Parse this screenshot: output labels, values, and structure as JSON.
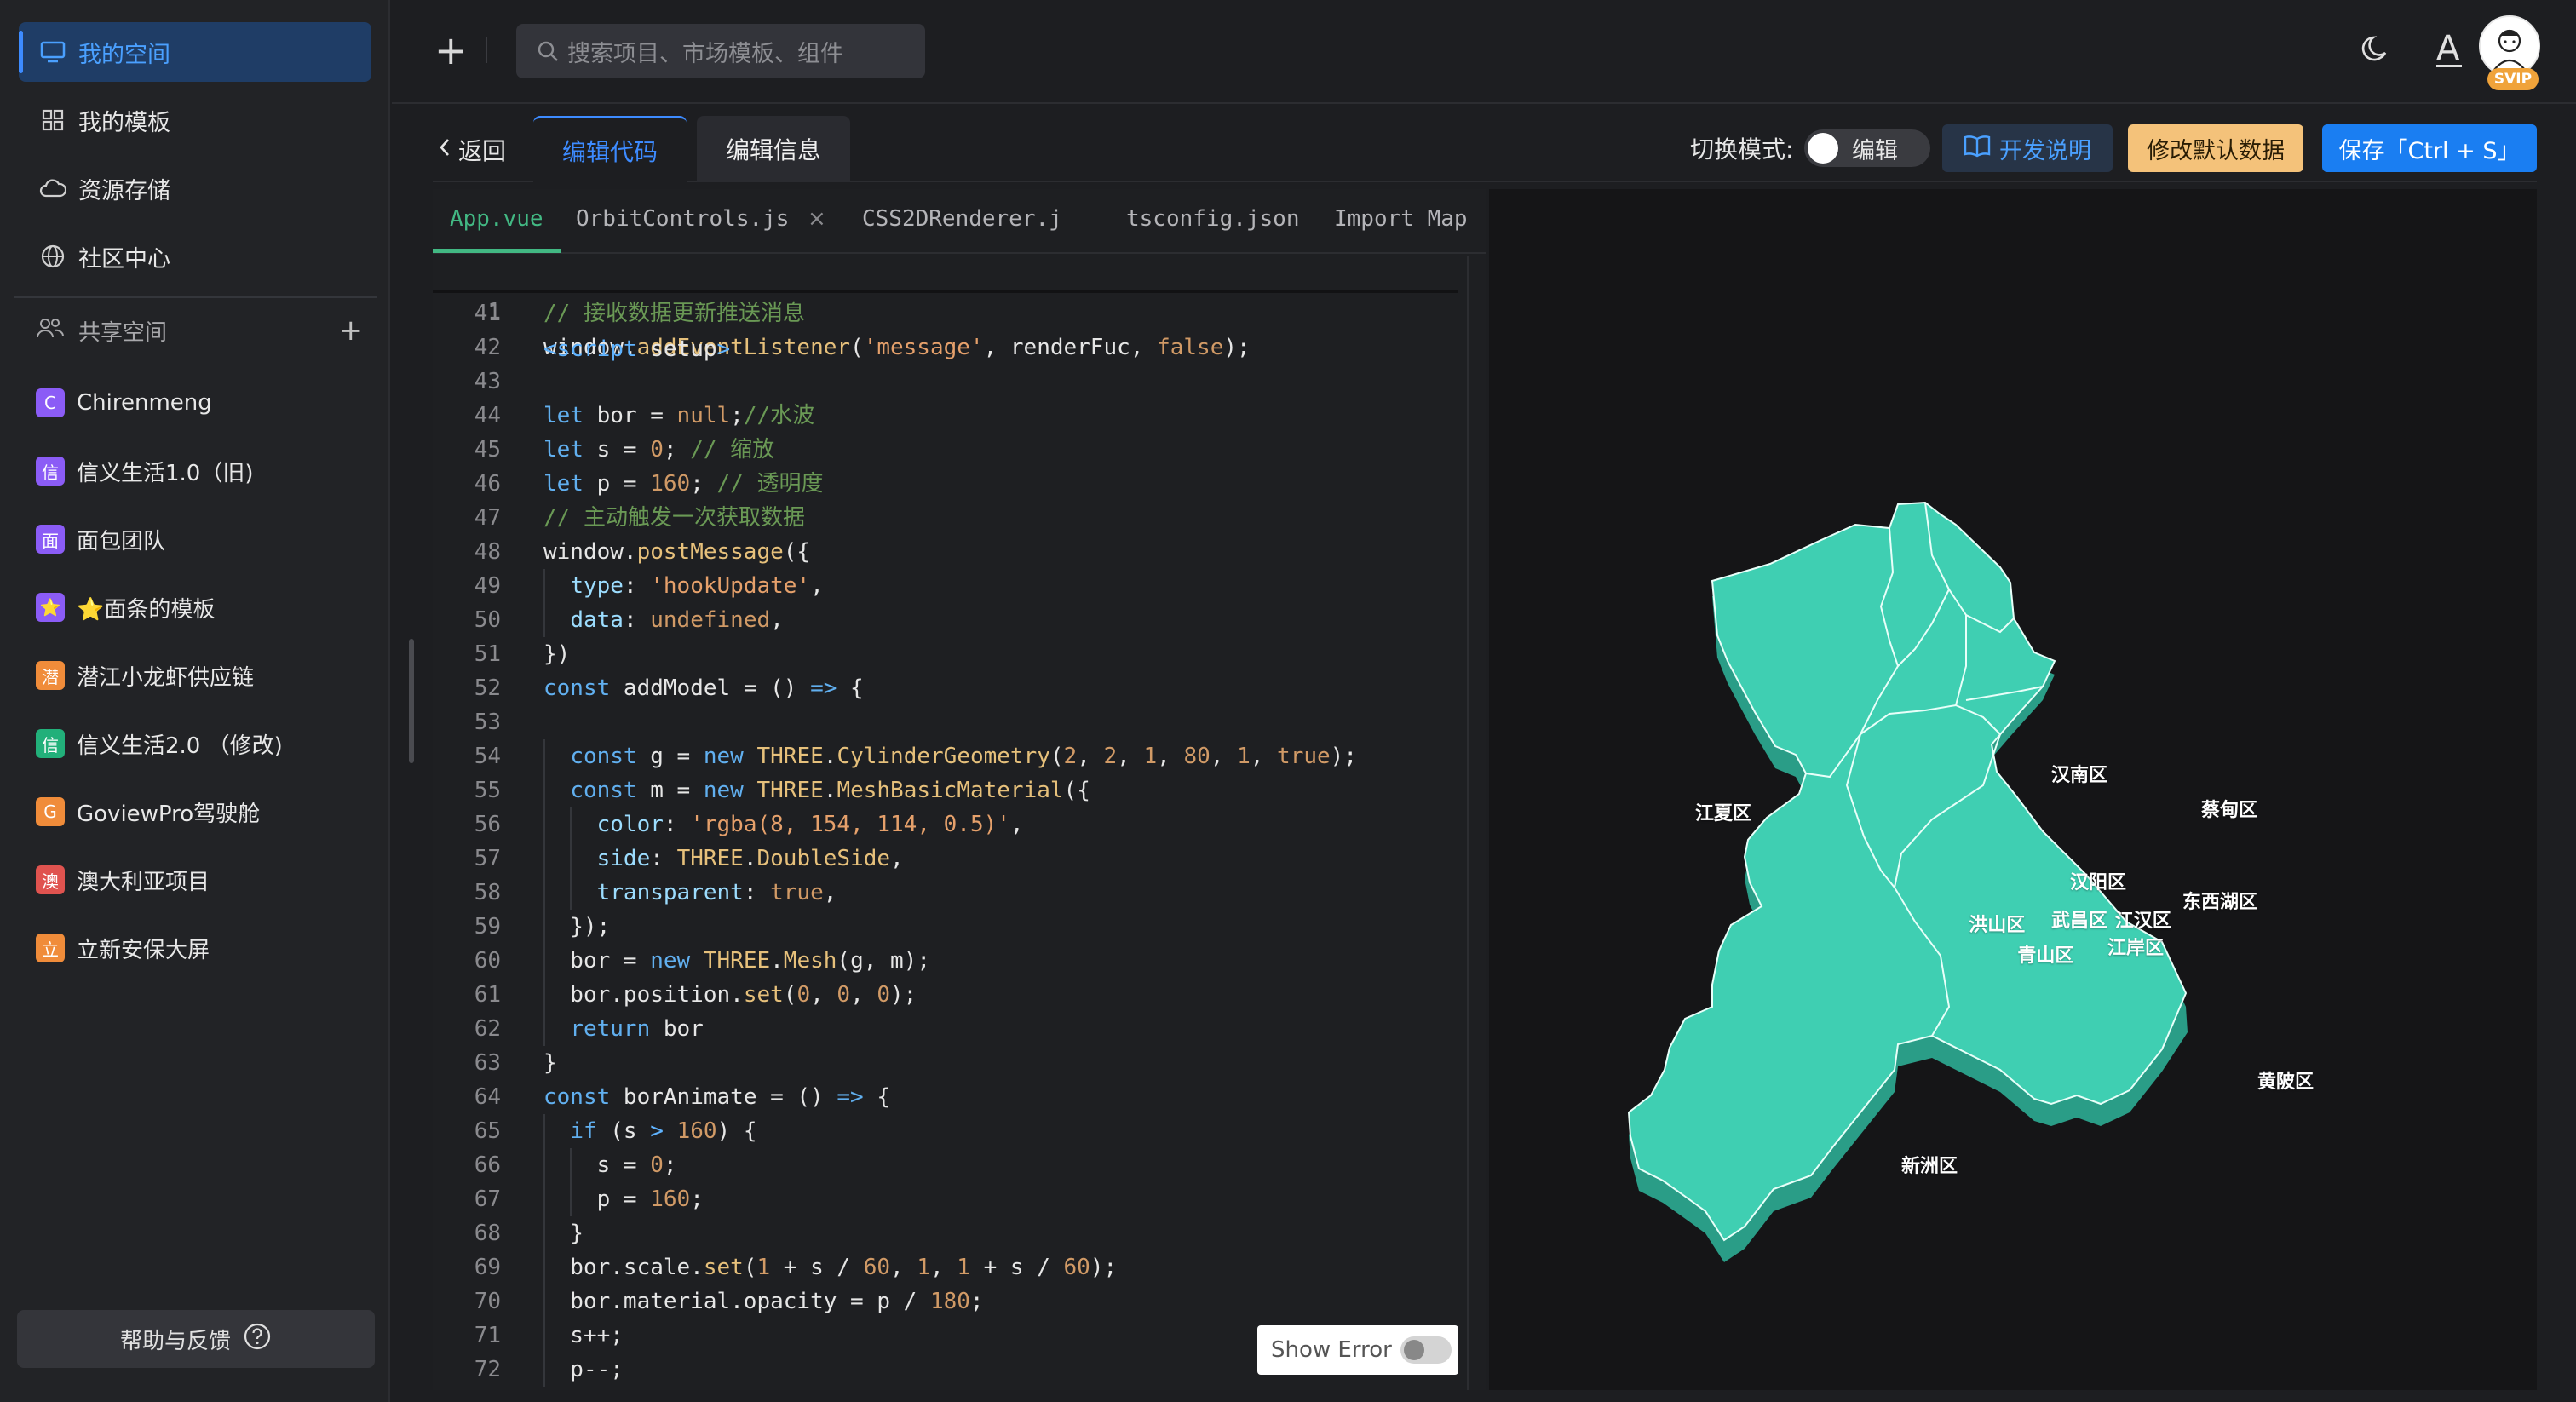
{
  "sidebar": {
    "nav": [
      {
        "label": "我的空间",
        "icon": "monitor-icon",
        "active": true
      },
      {
        "label": "我的模板",
        "icon": "template-icon",
        "active": false
      },
      {
        "label": "资源存储",
        "icon": "cloud-icon",
        "active": false
      },
      {
        "label": "社区中心",
        "icon": "globe-icon",
        "active": false
      }
    ],
    "shared_title": "共享空间",
    "teams": [
      {
        "badge": "C",
        "label": "Chirenmeng",
        "color": "#8b5cf6"
      },
      {
        "badge": "信",
        "label": "信义生活1.0（旧)",
        "color": "#8b5cf6"
      },
      {
        "badge": "面",
        "label": "面包团队",
        "color": "#8b5cf6"
      },
      {
        "badge": "⭐",
        "label": "⭐面条的模板",
        "color": "#8b5cf6"
      },
      {
        "badge": "潜",
        "label": "潜江小龙虾供应链",
        "color": "#f08c3a"
      },
      {
        "badge": "信",
        "label": "信义生活2.0 （修改)",
        "color": "#22b07a"
      },
      {
        "badge": "G",
        "label": "GoviewPro驾驶舱",
        "color": "#f08c3a"
      },
      {
        "badge": "澳",
        "label": "澳大利亚项目",
        "color": "#e0534f"
      },
      {
        "badge": "立",
        "label": "立新安保大屏",
        "color": "#f08c3a"
      }
    ],
    "help_label": "帮助与反馈"
  },
  "topbar": {
    "search_placeholder": "搜索项目、市场模板、组件",
    "font_letter": "A",
    "svip": "SVIP"
  },
  "toolbar": {
    "back_label": "返回",
    "tabs": [
      "编辑代码",
      "编辑信息"
    ],
    "mode_label": "切换模式:",
    "mode_value": "编辑",
    "doc_label": "开发说明",
    "default_data_label": "修改默认数据",
    "save_label": "保存「Ctrl + S」"
  },
  "editor": {
    "file_tabs": [
      "App.vue",
      "OrbitControls.js",
      "CSS2DRenderer.j",
      "tsconfig.json",
      "Import Map"
    ],
    "close_glyph": "×",
    "sticky": {
      "line": "1",
      "code": "<script setup>"
    },
    "lines": [
      {
        "n": "41",
        "code": "// 接收数据更新推送消息"
      },
      {
        "n": "42",
        "code": "window.addEventListener('message', renderFuc, false);"
      },
      {
        "n": "43",
        "code": ""
      },
      {
        "n": "44",
        "code": "let bor = null;//水波"
      },
      {
        "n": "45",
        "code": "let s = 0; // 缩放"
      },
      {
        "n": "46",
        "code": "let p = 160; // 透明度"
      },
      {
        "n": "47",
        "code": "// 主动触发一次获取数据"
      },
      {
        "n": "48",
        "code": "window.postMessage({"
      },
      {
        "n": "49",
        "code": "  type: 'hookUpdate',"
      },
      {
        "n": "50",
        "code": "  data: undefined,"
      },
      {
        "n": "51",
        "code": "})"
      },
      {
        "n": "52",
        "code": "const addModel = () => {"
      },
      {
        "n": "53",
        "code": ""
      },
      {
        "n": "54",
        "code": "  const g = new THREE.CylinderGeometry(2, 2, 1, 80, 1, true);"
      },
      {
        "n": "55",
        "code": "  const m = new THREE.MeshBasicMaterial({"
      },
      {
        "n": "56",
        "code": "    color: 'rgba(8, 154, 114, 0.5)',"
      },
      {
        "n": "57",
        "code": "    side: THREE.DoubleSide,"
      },
      {
        "n": "58",
        "code": "    transparent: true,"
      },
      {
        "n": "59",
        "code": "  });"
      },
      {
        "n": "60",
        "code": "  bor = new THREE.Mesh(g, m);"
      },
      {
        "n": "61",
        "code": "  bor.position.set(0, 0, 0);"
      },
      {
        "n": "62",
        "code": "  return bor"
      },
      {
        "n": "63",
        "code": "}"
      },
      {
        "n": "64",
        "code": "const borAnimate = () => {"
      },
      {
        "n": "65",
        "code": "  if (s > 160) {"
      },
      {
        "n": "66",
        "code": "    s = 0;"
      },
      {
        "n": "67",
        "code": "    p = 160;"
      },
      {
        "n": "68",
        "code": "  }"
      },
      {
        "n": "69",
        "code": "  bor.scale.set(1 + s / 60, 1, 1 + s / 60);"
      },
      {
        "n": "70",
        "code": "  bor.material.opacity = p / 180;"
      },
      {
        "n": "71",
        "code": "  s++;"
      },
      {
        "n": "72",
        "code": "  p--;"
      }
    ],
    "show_error_label": "Show Error"
  },
  "preview": {
    "districts": [
      "汉南区",
      "蔡甸区",
      "江夏区",
      "汉阳区",
      "东西湖区",
      "洪山区",
      "武昌区",
      "江汉区",
      "青山区",
      "江岸区",
      "黄陂区",
      "新洲区"
    ],
    "map_colors": {
      "top": "#3fd1b4",
      "side": "#2a9d87",
      "border": "#e8fff9"
    }
  }
}
